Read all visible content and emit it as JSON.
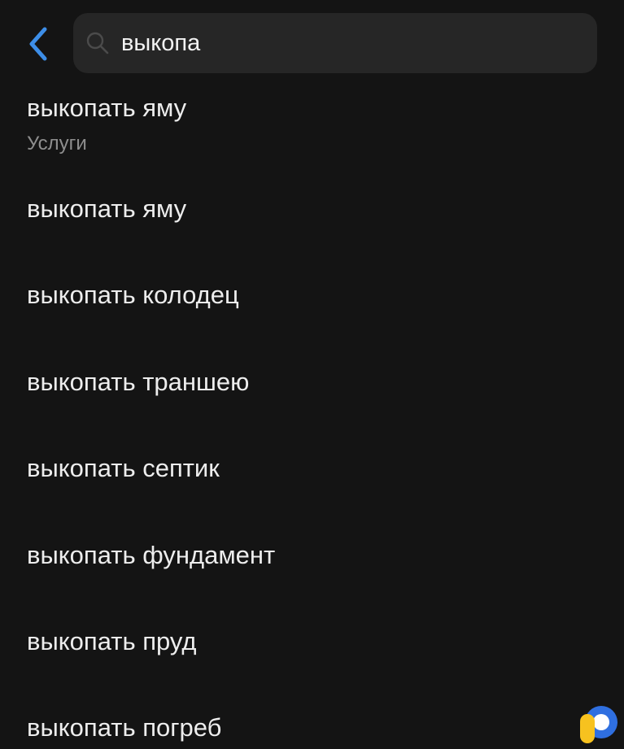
{
  "search": {
    "query": "выкопа"
  },
  "suggestions": [
    {
      "title": "выкопать яму",
      "category": "Услуги"
    },
    {
      "title": "выкопать яму"
    },
    {
      "title": "выкопать колодец"
    },
    {
      "title": "выкопать траншею"
    },
    {
      "title": "выкопать септик"
    },
    {
      "title": "выкопать фундамент"
    },
    {
      "title": "выкопать пруд"
    },
    {
      "title": "выкопать погреб"
    }
  ],
  "colors": {
    "background": "#141414",
    "search_field": "#262626",
    "accent_back": "#3d8ee8",
    "text_primary": "#ededed",
    "text_secondary": "#8e8e8e",
    "fab_yellow": "#f7c21f",
    "fab_blue": "#2f6fe0"
  },
  "icons": {
    "back": "chevron-left-icon",
    "search": "search-icon",
    "fab": "assistant-logo-icon"
  }
}
